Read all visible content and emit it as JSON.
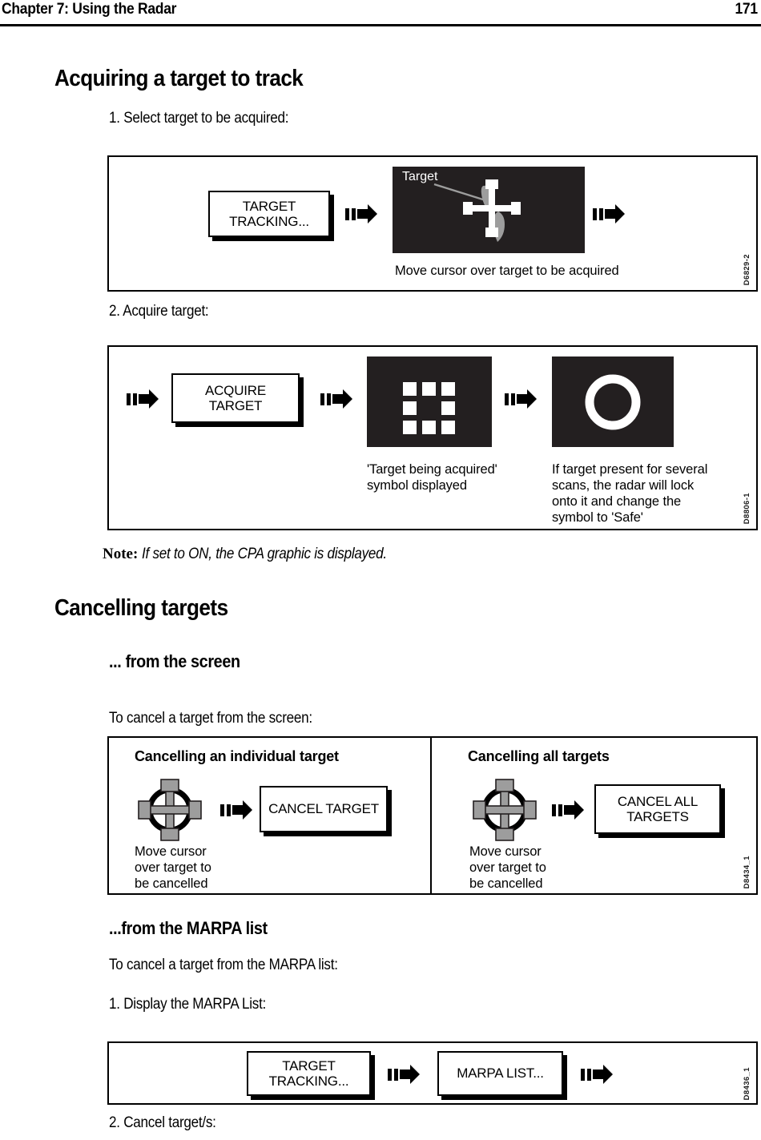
{
  "header": {
    "chapter": "Chapter 7: Using the Radar",
    "page_number": "171"
  },
  "sections": {
    "acquiring_heading": "Acquiring a target to track",
    "step1": "1.   Select target to be acquired:",
    "step2": "2.   Acquire target:",
    "note_label": "Note:",
    "note_text": "If set to ON, the CPA graphic is displayed.",
    "cancelling_heading": "Cancelling targets",
    "from_screen_heading": "... from the screen",
    "from_screen_intro": "To cancel a target from the screen:",
    "from_marpa_heading": "...from the MARPA list",
    "from_marpa_intro": "To cancel a target from the MARPA list:",
    "marpa_step1": "1.   Display the MARPA List:",
    "marpa_step2": "2.  Cancel target/s:"
  },
  "figure1": {
    "ref": "D6829-2",
    "softkey_line1": "TARGET",
    "softkey_line2": "TRACKING...",
    "target_label": "Target",
    "caption": "Move cursor over target to be acquired"
  },
  "figure2": {
    "ref": "D8806-1",
    "softkey": "ACQUIRE TARGET",
    "caption_a_line1": "'Target being acquired'",
    "caption_a_line2": "symbol displayed",
    "caption_b_line1": "If target present for several",
    "caption_b_line2": "scans, the radar will lock",
    "caption_b_line3": "onto it and change the",
    "caption_b_line4": "symbol to  'Safe'"
  },
  "figure3": {
    "ref": "D8434_1",
    "left_title": "Cancelling an individual target",
    "left_caption_line1": "Move cursor",
    "left_caption_line2": "over target to",
    "left_caption_line3": "be cancelled",
    "left_softkey": "CANCEL TARGET",
    "right_title": "Cancelling all targets",
    "right_caption_line1": "Move cursor",
    "right_caption_line2": "over target to",
    "right_caption_line3": "be cancelled",
    "right_softkey_line1": "CANCEL ALL",
    "right_softkey_line2": "TARGETS"
  },
  "figure4": {
    "ref": "D8436_1",
    "softkey1_line1": "TARGET",
    "softkey1_line2": "TRACKING...",
    "softkey2": "MARPA LIST..."
  },
  "colors": {
    "radar_background": "#231f20",
    "cursor_gray": "#9d9d9d",
    "ink": "#000000",
    "paper": "#ffffff"
  },
  "icons": {
    "arrow": "right-arrow-icon",
    "cursor": "radar-cursor-icon",
    "acquiring": "target-being-acquired-symbol",
    "safe": "safe-target-symbol"
  }
}
